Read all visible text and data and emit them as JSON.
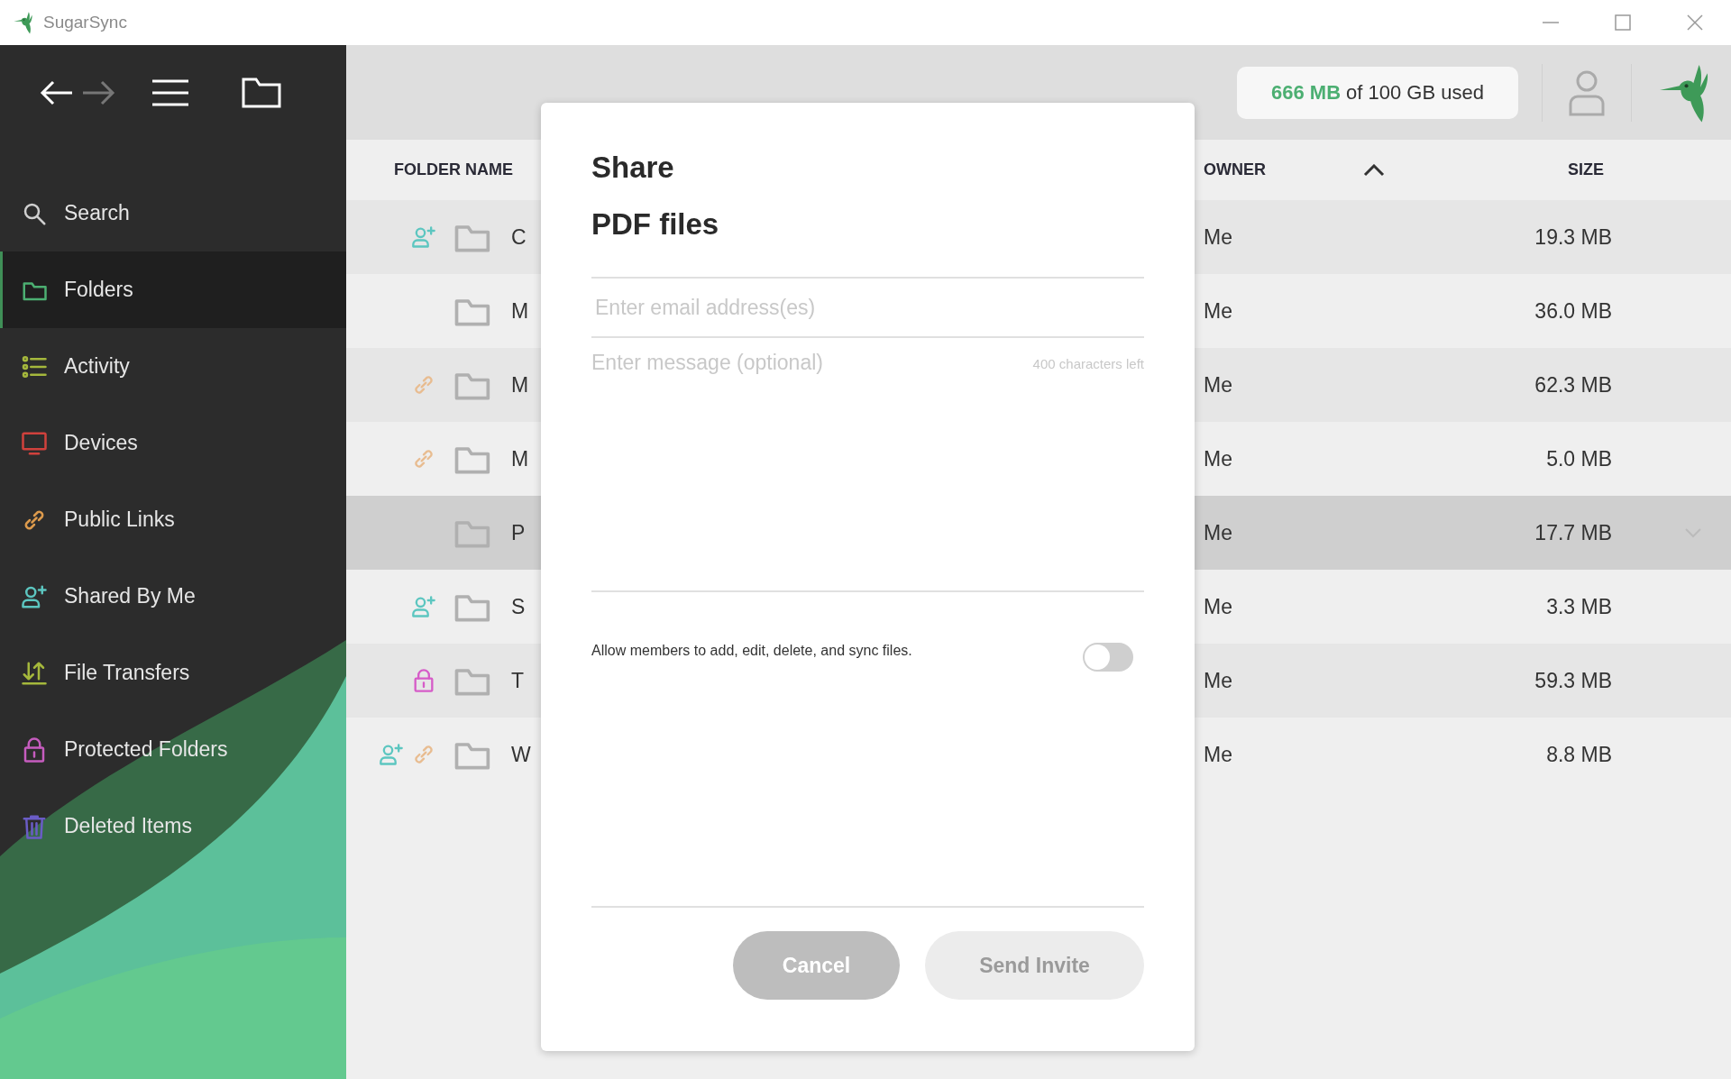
{
  "window": {
    "title": "SugarSync"
  },
  "sidebar": {
    "items": [
      {
        "label": "Search",
        "kind": "search",
        "color": "#cfcfcf",
        "selected": false
      },
      {
        "label": "Folders",
        "kind": "folder",
        "color": "#4caf72",
        "selected": true
      },
      {
        "label": "Activity",
        "kind": "list",
        "color": "#a5b83c",
        "selected": false
      },
      {
        "label": "Devices",
        "kind": "monitor",
        "color": "#d0413c",
        "selected": false
      },
      {
        "label": "Public Links",
        "kind": "link",
        "color": "#dc9a4c",
        "selected": false
      },
      {
        "label": "Shared By Me",
        "kind": "share",
        "color": "#5cc6c0",
        "selected": false
      },
      {
        "label": "File Transfers",
        "kind": "transfer",
        "color": "#a5b83c",
        "selected": false
      },
      {
        "label": "Protected Folders",
        "kind": "lock",
        "color": "#c65cbf",
        "selected": false
      },
      {
        "label": "Deleted Items",
        "kind": "trash",
        "color": "#6a5cc6",
        "selected": false
      }
    ]
  },
  "storage": {
    "used": "666 MB",
    "rest": "of 100 GB used"
  },
  "table": {
    "columns": [
      "FOLDER NAME",
      "OWNER",
      "SIZE"
    ],
    "rows": [
      {
        "badges": [
          {
            "kind": "share"
          }
        ],
        "name": "C",
        "owner": "Me",
        "size": "19.3 MB",
        "selected": false
      },
      {
        "badges": [],
        "name": "M",
        "owner": "Me",
        "size": "36.0 MB",
        "selected": false
      },
      {
        "badges": [
          {
            "kind": "link"
          }
        ],
        "name": "M",
        "owner": "Me",
        "size": "62.3 MB",
        "selected": false
      },
      {
        "badges": [
          {
            "kind": "link"
          }
        ],
        "name": "M",
        "owner": "Me",
        "size": "5.0 MB",
        "selected": false
      },
      {
        "badges": [],
        "name": "P",
        "owner": "Me",
        "size": "17.7 MB",
        "selected": true
      },
      {
        "badges": [
          {
            "kind": "share"
          }
        ],
        "name": "S",
        "owner": "Me",
        "size": "3.3 MB",
        "selected": false
      },
      {
        "badges": [
          {
            "kind": "lock"
          }
        ],
        "name": "T",
        "owner": "Me",
        "size": "59.3 MB",
        "selected": false
      },
      {
        "badges": [
          {
            "kind": "share"
          },
          {
            "kind": "link"
          }
        ],
        "name": "W",
        "owner": "Me",
        "size": "8.8 MB",
        "selected": false
      }
    ]
  },
  "dialog": {
    "title": "Share",
    "subtitle": "PDF files",
    "email_placeholder": "Enter email address(es)",
    "message_placeholder": "Enter message (optional)",
    "counter": "400 characters left",
    "permission": {
      "label": "Allow members to add, edit, delete, and sync files.",
      "on": false
    },
    "buttons": [
      {
        "label": "Cancel",
        "kind": "secondary",
        "disabled": false
      },
      {
        "label": "Send Invite",
        "kind": "primary",
        "disabled": true
      }
    ]
  }
}
